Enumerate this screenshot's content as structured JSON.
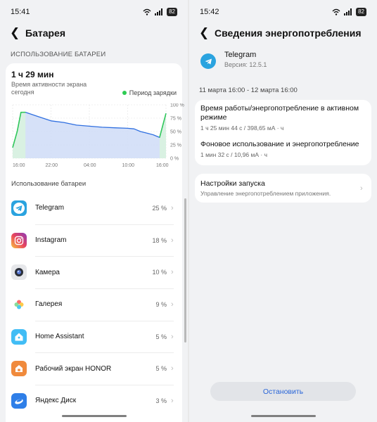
{
  "left": {
    "status": {
      "time": "15:41",
      "battery": "82"
    },
    "header": {
      "title": "Батарея"
    },
    "section_title": "ИСПОЛЬЗОВАНИЕ БАТАРЕИ",
    "usage": {
      "time": "1 ч 29 мин",
      "description": "Время активности экрана сегодня",
      "charging_legend": "Период зарядки"
    },
    "chart_data": {
      "type": "area",
      "x_ticks": [
        "16:00",
        "22:00",
        "04:00",
        "10:00",
        "16:00"
      ],
      "y_ticks": [
        "100 %",
        "75 %",
        "50 %",
        "25 %",
        "0 %"
      ],
      "ylim": [
        0,
        100
      ],
      "grid": true,
      "series": [
        {
          "x_hours": [
            0,
            0.7,
            1.3,
            2,
            4,
            6,
            8,
            10,
            12,
            14,
            16,
            18,
            19,
            20,
            21,
            22,
            23,
            23.5,
            24
          ],
          "values": [
            20,
            50,
            86,
            86,
            78,
            70,
            67,
            62,
            60,
            58,
            57,
            56,
            55,
            50,
            47,
            44,
            39,
            62,
            84
          ]
        }
      ],
      "charging_periods": [
        [
          0,
          2
        ],
        [
          23,
          24
        ]
      ],
      "colors": {
        "line": "#2f6fe0",
        "fill": "#cfdcf7",
        "charging": "#2ecb53",
        "charging_fill": "#d9f3df"
      }
    },
    "list_heading": "Использование батареи",
    "apps": [
      {
        "name": "Telegram",
        "pct": "25 %",
        "icon": "telegram-icon"
      },
      {
        "name": "Instagram",
        "pct": "18 %",
        "icon": "instagram-icon"
      },
      {
        "name": "Камера",
        "pct": "10 %",
        "icon": "camera-icon"
      },
      {
        "name": "Галерея",
        "pct": "9 %",
        "icon": "gallery-icon"
      },
      {
        "name": "Home Assistant",
        "pct": "5 %",
        "icon": "home-assistant-icon"
      },
      {
        "name": "Рабочий экран HONOR",
        "pct": "5 %",
        "icon": "honor-home-icon"
      },
      {
        "name": "Яндекс Диск",
        "pct": "3 %",
        "icon": "yandex-disk-icon"
      }
    ]
  },
  "right": {
    "status": {
      "time": "15:42",
      "battery": "82"
    },
    "header": {
      "title": "Сведения энергопотребления"
    },
    "app": {
      "name": "Telegram",
      "version": "Версия: 12.5.1"
    },
    "range": "11 марта 16:00 - 12 марта 16:00",
    "active": {
      "title": "Время работы/энергопотребление в активном режиме",
      "value": "1 ч 25 мин 44 с / 398,65 мА · ч"
    },
    "background": {
      "title": "Фоновое использование и энергопотребление",
      "value": "1 мин 32 с / 10,96 мА · ч"
    },
    "launch": {
      "title": "Настройки запуска",
      "subtitle": "Управление энергопотреблением приложения."
    },
    "stop_button": "Остановить"
  }
}
